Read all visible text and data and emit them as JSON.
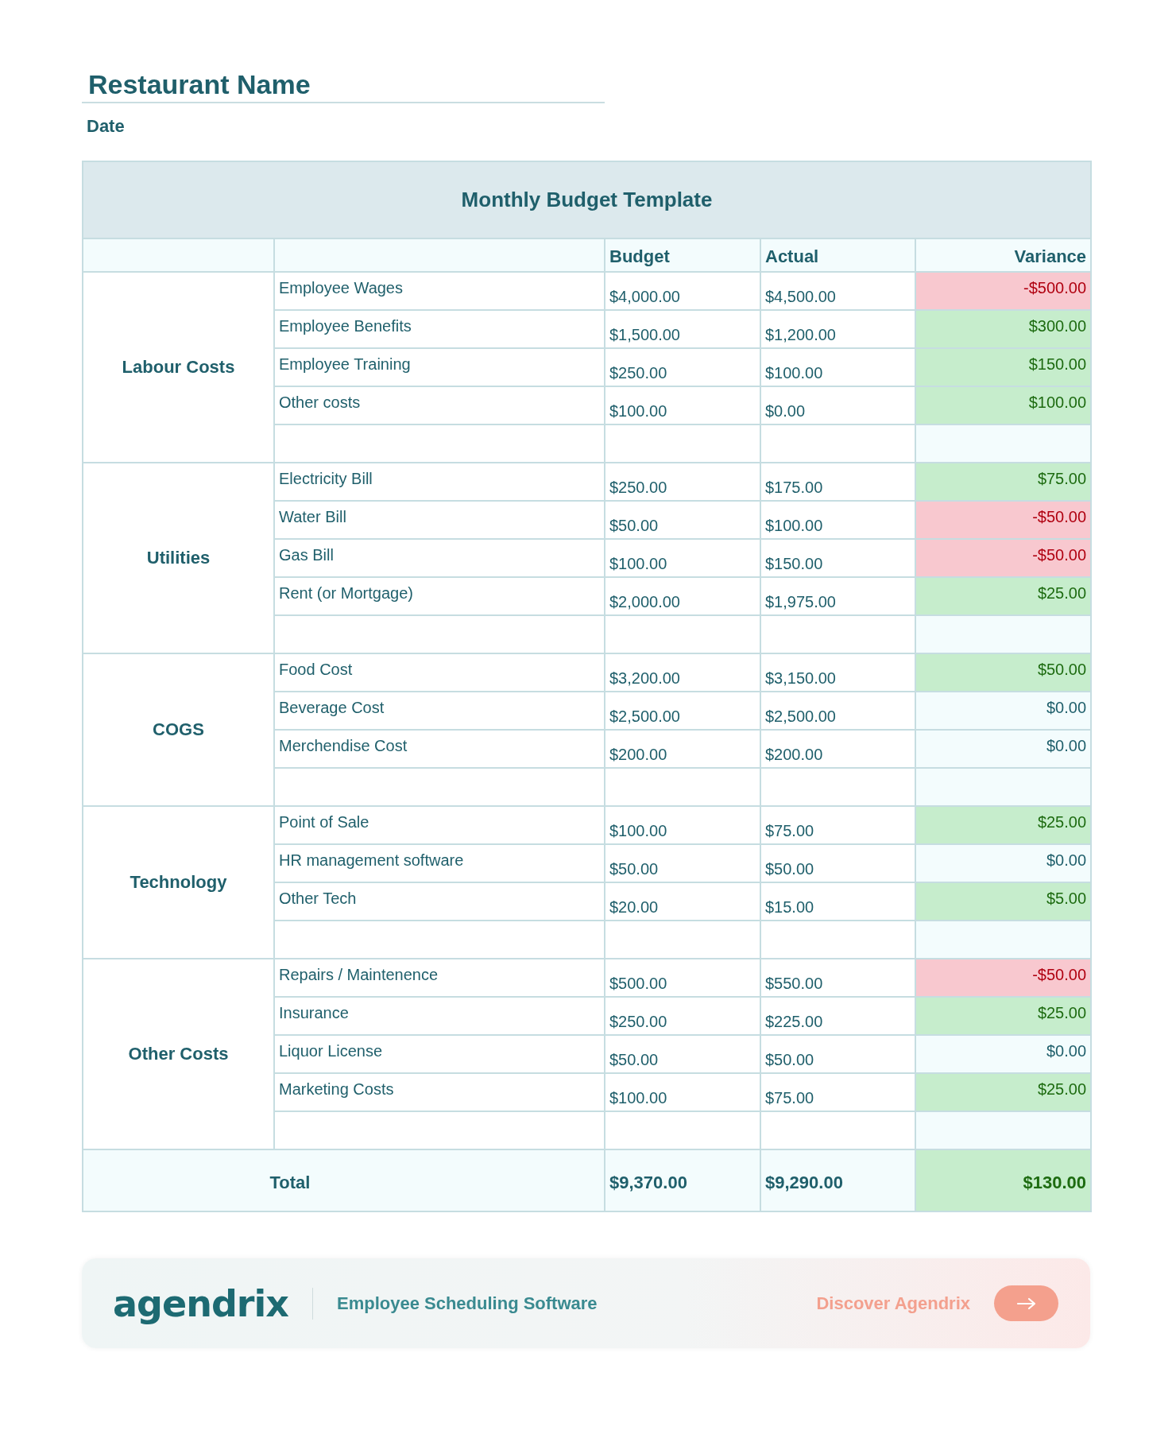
{
  "restaurant_name": "Restaurant Name",
  "date_label": "Date",
  "table": {
    "title": "Monthly Budget Template",
    "columns": [
      "Budget",
      "Actual",
      "Variance"
    ],
    "groups": [
      {
        "category": "Labour Costs",
        "rows": [
          {
            "item": "Employee Wages",
            "budget": "$4,000.00",
            "actual": "$4,500.00",
            "variance": "-$500.00",
            "kind": "negative"
          },
          {
            "item": "Employee Benefits",
            "budget": "$1,500.00",
            "actual": "$1,200.00",
            "variance": "$300.00",
            "kind": "positive"
          },
          {
            "item": "Employee Training",
            "budget": "$250.00",
            "actual": "$100.00",
            "variance": "$150.00",
            "kind": "positive"
          },
          {
            "item": "Other costs",
            "budget": "$100.00",
            "actual": "$0.00",
            "variance": "$100.00",
            "kind": "positive"
          }
        ]
      },
      {
        "category": "Utilities",
        "rows": [
          {
            "item": "Electricity Bill",
            "budget": "$250.00",
            "actual": "$175.00",
            "variance": "$75.00",
            "kind": "positive"
          },
          {
            "item": "Water Bill",
            "budget": "$50.00",
            "actual": "$100.00",
            "variance": "-$50.00",
            "kind": "negative"
          },
          {
            "item": "Gas Bill",
            "budget": "$100.00",
            "actual": "$150.00",
            "variance": "-$50.00",
            "kind": "negative"
          },
          {
            "item": "Rent (or Mortgage)",
            "budget": "$2,000.00",
            "actual": "$1,975.00",
            "variance": "$25.00",
            "kind": "positive"
          }
        ]
      },
      {
        "category": "COGS",
        "rows": [
          {
            "item": "Food Cost",
            "budget": "$3,200.00",
            "actual": "$3,150.00",
            "variance": "$50.00",
            "kind": "positive"
          },
          {
            "item": "Beverage Cost",
            "budget": "$2,500.00",
            "actual": "$2,500.00",
            "variance": "$0.00",
            "kind": "zero"
          },
          {
            "item": "Merchendise Cost",
            "budget": "$200.00",
            "actual": "$200.00",
            "variance": "$0.00",
            "kind": "zero"
          }
        ]
      },
      {
        "category": "Technology",
        "rows": [
          {
            "item": "Point of Sale",
            "budget": "$100.00",
            "actual": "$75.00",
            "variance": "$25.00",
            "kind": "positive"
          },
          {
            "item": "HR management software",
            "budget": "$50.00",
            "actual": "$50.00",
            "variance": "$0.00",
            "kind": "zero"
          },
          {
            "item": "Other Tech",
            "budget": "$20.00",
            "actual": "$15.00",
            "variance": "$5.00",
            "kind": "positive"
          }
        ]
      },
      {
        "category": "Other Costs",
        "rows": [
          {
            "item": "Repairs / Maintenence",
            "budget": "$500.00",
            "actual": "$550.00",
            "variance": "-$50.00",
            "kind": "negative"
          },
          {
            "item": "Insurance",
            "budget": "$250.00",
            "actual": "$225.00",
            "variance": "$25.00",
            "kind": "positive"
          },
          {
            "item": "Liquor License",
            "budget": "$50.00",
            "actual": "$50.00",
            "variance": "$0.00",
            "kind": "zero"
          },
          {
            "item": "Marketing Costs",
            "budget": "$100.00",
            "actual": "$75.00",
            "variance": "$25.00",
            "kind": "positive"
          }
        ]
      }
    ],
    "total": {
      "label": "Total",
      "budget": "$9,370.00",
      "actual": "$9,290.00",
      "variance": "$130.00",
      "kind": "positive"
    }
  },
  "banner": {
    "logo": "agendrix",
    "tagline": "Employee Scheduling Software",
    "cta": "Discover Agendrix"
  }
}
